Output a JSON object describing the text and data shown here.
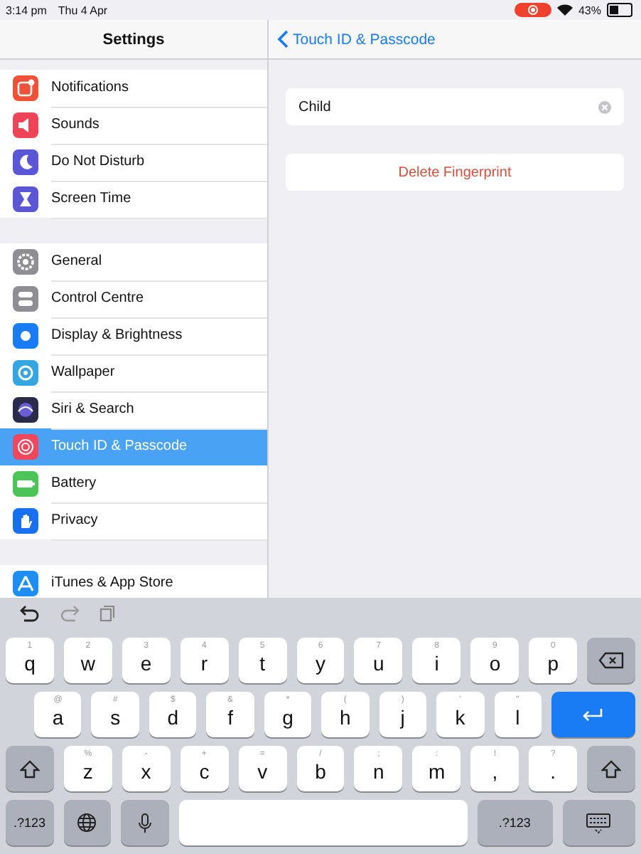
{
  "status_bar": {
    "time": "3:14 pm",
    "date": "Thu 4 Apr",
    "battery": "43%",
    "recording": true
  },
  "sidebar": {
    "title": "Settings",
    "groups": [
      [
        {
          "label": "Notifications",
          "kind": "notifications",
          "color": "#f0513a",
          "selected": false
        },
        {
          "label": "Sounds",
          "kind": "sounds",
          "color": "#ef4358",
          "selected": false
        },
        {
          "label": "Do Not Disturb",
          "kind": "moon",
          "color": "#5a56d6",
          "selected": false
        },
        {
          "label": "Screen Time",
          "kind": "hourglass",
          "color": "#5a56d6",
          "selected": false
        }
      ],
      [
        {
          "label": "General",
          "kind": "gear",
          "color": "#8e8e93",
          "selected": false
        },
        {
          "label": "Control Centre",
          "kind": "toggles",
          "color": "#8e8e93",
          "selected": false
        },
        {
          "label": "Display & Brightness",
          "kind": "display",
          "color": "#1a7cf5",
          "selected": false
        },
        {
          "label": "Wallpaper",
          "kind": "flower",
          "color": "#35a6e0",
          "selected": false
        },
        {
          "label": "Siri & Search",
          "kind": "siri",
          "color": "#2a2a4a",
          "selected": false
        },
        {
          "label": "Touch ID & Passcode",
          "kind": "fingerprint",
          "color": "#f0475d",
          "selected": true
        },
        {
          "label": "Battery",
          "kind": "battery",
          "color": "#4cc45a",
          "selected": false
        },
        {
          "label": "Privacy",
          "kind": "hand",
          "color": "#1a6ff0",
          "selected": false
        }
      ],
      [
        {
          "label": "iTunes & App Store",
          "kind": "store",
          "color": "#1f8ef2",
          "selected": false
        }
      ]
    ]
  },
  "detail": {
    "back": "Touch ID & Passcode",
    "name_field": {
      "value": "Child"
    },
    "delete_button": "Delete Fingerprint"
  },
  "keyboard": {
    "rows": [
      [
        {
          "kind": "letter",
          "label": "q",
          "hint": "1"
        },
        {
          "kind": "letter",
          "label": "w",
          "hint": "2"
        },
        {
          "kind": "letter",
          "label": "e",
          "hint": "3"
        },
        {
          "kind": "letter",
          "label": "r",
          "hint": "4"
        },
        {
          "kind": "letter",
          "label": "t",
          "hint": "5"
        },
        {
          "kind": "letter",
          "label": "y",
          "hint": "6"
        },
        {
          "kind": "letter",
          "label": "u",
          "hint": "7"
        },
        {
          "kind": "letter",
          "label": "i",
          "hint": "8"
        },
        {
          "kind": "letter",
          "label": "o",
          "hint": "9"
        },
        {
          "kind": "letter",
          "label": "p",
          "hint": "0"
        },
        {
          "kind": "delete"
        }
      ],
      [
        {
          "kind": "letter",
          "label": "a",
          "hint": "@"
        },
        {
          "kind": "letter",
          "label": "s",
          "hint": "#"
        },
        {
          "kind": "letter",
          "label": "d",
          "hint": "$"
        },
        {
          "kind": "letter",
          "label": "f",
          "hint": "&"
        },
        {
          "kind": "letter",
          "label": "g",
          "hint": "*"
        },
        {
          "kind": "letter",
          "label": "h",
          "hint": "("
        },
        {
          "kind": "letter",
          "label": "j",
          "hint": ")"
        },
        {
          "kind": "letter",
          "label": "k",
          "hint": "'"
        },
        {
          "kind": "letter",
          "label": "l",
          "hint": "\""
        },
        {
          "kind": "return"
        }
      ],
      [
        {
          "kind": "shift"
        },
        {
          "kind": "letter",
          "label": "z",
          "hint": "%"
        },
        {
          "kind": "letter",
          "label": "x",
          "hint": "-"
        },
        {
          "kind": "letter",
          "label": "c",
          "hint": "+"
        },
        {
          "kind": "letter",
          "label": "v",
          "hint": "="
        },
        {
          "kind": "letter",
          "label": "b",
          "hint": "/"
        },
        {
          "kind": "letter",
          "label": "n",
          "hint": ";"
        },
        {
          "kind": "letter",
          "label": "m",
          "hint": ":"
        },
        {
          "kind": "punct",
          "label": ",",
          "hint": "!"
        },
        {
          "kind": "punct",
          "label": ".",
          "hint": "?"
        },
        {
          "kind": "shift"
        }
      ],
      [
        {
          "kind": "symbols",
          "label": ".?123"
        },
        {
          "kind": "globe"
        },
        {
          "kind": "mic"
        },
        {
          "kind": "space"
        },
        {
          "kind": "symbols",
          "label": ".?123"
        },
        {
          "kind": "hide"
        }
      ]
    ]
  }
}
